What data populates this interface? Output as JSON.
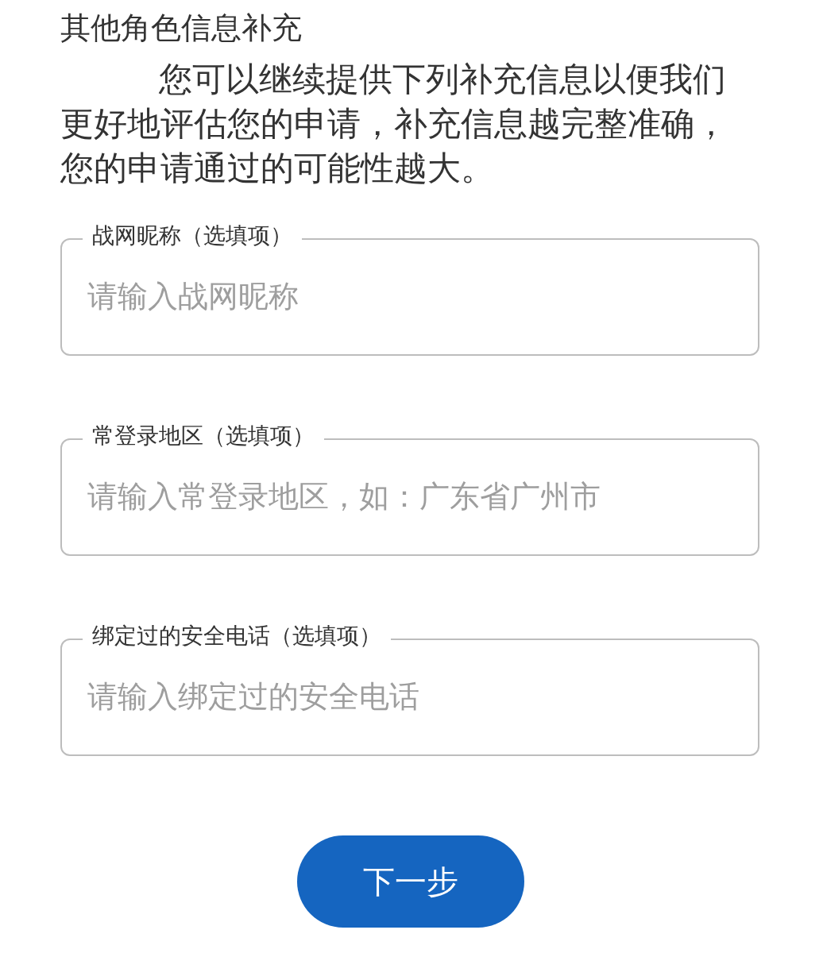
{
  "section_title": "其他角色信息补充",
  "intro": "您可以继续提供下列补充信息以便我们更好地评估您的申请，补充信息越完整准确，您的申请通过的可能性越大。",
  "fields": [
    {
      "label": "战网昵称（选填项）",
      "placeholder": "请输入战网昵称"
    },
    {
      "label": "常登录地区（选填项）",
      "placeholder": "请输入常登录地区，如：广东省广州市"
    },
    {
      "label": "绑定过的安全电话（选填项）",
      "placeholder": "请输入绑定过的安全电话"
    }
  ],
  "next_button": "下一步"
}
